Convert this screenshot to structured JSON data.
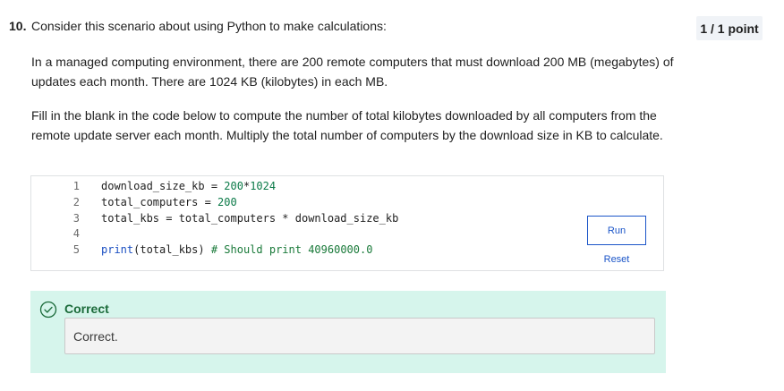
{
  "question": {
    "number": "10.",
    "title": "Consider this scenario about using Python to make calculations:",
    "points": "1 / 1 point",
    "paragraph1": "In a managed computing environment, there are 200 remote computers that must download 200 MB (megabytes) of updates each month. There are 1024 KB (kilobytes) in each MB.",
    "paragraph2": "Fill in the blank in the code below to compute the number of total kilobytes downloaded by all computers from the remote update server each month. Multiply the total number of computers by the download size in KB to calculate."
  },
  "code": {
    "lines": [
      {
        "num": "1",
        "tokens": [
          {
            "t": "download_size_kb = ",
            "c": "plain"
          },
          {
            "t": "200",
            "c": "num"
          },
          {
            "t": "*",
            "c": "plain"
          },
          {
            "t": "1024",
            "c": "num"
          }
        ]
      },
      {
        "num": "2",
        "tokens": [
          {
            "t": "total_computers = ",
            "c": "plain"
          },
          {
            "t": "200",
            "c": "num"
          }
        ]
      },
      {
        "num": "3",
        "tokens": [
          {
            "t": "total_kbs = total_computers * download_size_kb",
            "c": "plain"
          }
        ]
      },
      {
        "num": "4",
        "tokens": []
      },
      {
        "num": "5",
        "tokens": [
          {
            "t": "print",
            "c": "fn"
          },
          {
            "t": "(total_kbs) ",
            "c": "plain"
          },
          {
            "t": "# Should print 40960000.0",
            "c": "cmt"
          }
        ]
      }
    ],
    "run_label": "Run",
    "reset_label": "Reset"
  },
  "feedback": {
    "icon": "check-circle-icon",
    "title": "Correct",
    "message": "Correct.",
    "colors": {
      "background": "#d6f5ec",
      "title": "#1b6b3a"
    }
  },
  "colors": {
    "link": "#1b55c8",
    "number_token": "#0b7a48",
    "function_token": "#1a4fc2",
    "comment_token": "#1a7a3a"
  }
}
